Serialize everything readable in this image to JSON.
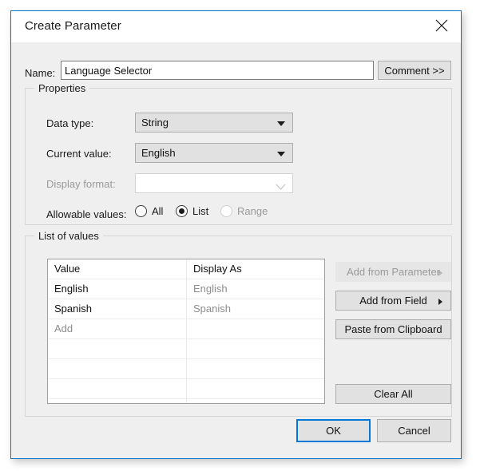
{
  "window": {
    "title": "Create Parameter",
    "close_icon": "close-icon",
    "accent_color": "#0078d7",
    "border_color": "#0a74c8",
    "body_background": "#efefef"
  },
  "name_row": {
    "label": "Name:",
    "value": "Language Selector",
    "placeholder": "",
    "comment_button": "Comment >>"
  },
  "properties": {
    "group_label": "Properties",
    "data_type": {
      "label": "Data type:",
      "value": "String",
      "icon": "chevron-down-icon"
    },
    "current_value": {
      "label": "Current value:",
      "value": "English",
      "icon": "chevron-down-icon"
    },
    "display_format": {
      "label": "Display format:",
      "value": "",
      "disabled": true,
      "icon": "chevron-down-icon"
    },
    "allowable_values": {
      "label": "Allowable values:",
      "options": [
        {
          "label": "All",
          "selected": false,
          "disabled": false
        },
        {
          "label": "List",
          "selected": true,
          "disabled": false
        },
        {
          "label": "Range",
          "selected": false,
          "disabled": true
        }
      ]
    }
  },
  "list_of_values": {
    "group_label": "List of values",
    "columns": [
      "Value",
      "Display As"
    ],
    "rows": [
      {
        "value": "English",
        "display_as": "English"
      },
      {
        "value": "Spanish",
        "display_as": "Spanish"
      },
      {
        "value": "Add",
        "display_as": ""
      }
    ],
    "add_row_placeholder": "Add",
    "empty_row_count": 4,
    "buttons": {
      "add_from_parameter": "Add from Parameter",
      "add_from_field": "Add from Field",
      "paste_from_clipboard": "Paste from Clipboard",
      "clear_all": "Clear All"
    }
  },
  "footer": {
    "ok": "OK",
    "cancel": "Cancel"
  }
}
